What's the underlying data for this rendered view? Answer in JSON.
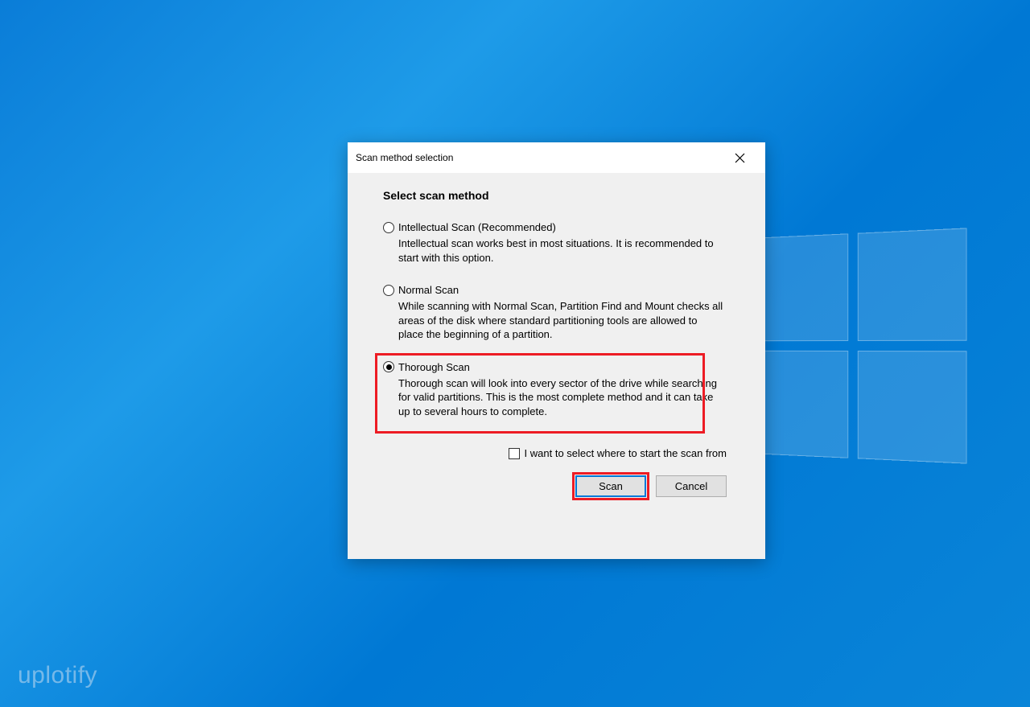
{
  "dialog": {
    "title": "Scan method selection",
    "heading": "Select scan method",
    "options": [
      {
        "label": "Intellectual Scan (Recommended)",
        "description": "Intellectual scan works best in most situations. It is recommended to start with this option.",
        "selected": false
      },
      {
        "label": "Normal Scan",
        "description": "While scanning with Normal Scan, Partition Find and Mount checks all areas of the disk where standard partitioning tools are allowed to place the beginning of a partition.",
        "selected": false
      },
      {
        "label": "Thorough Scan",
        "description": "Thorough scan will look into every sector of the drive while searching for valid partitions. This is the most complete method and it can take up to several hours to complete.",
        "selected": true
      }
    ],
    "checkbox_label": "I want to select where to start the scan from",
    "buttons": {
      "scan": "Scan",
      "cancel": "Cancel"
    }
  },
  "watermark": "uplotify"
}
